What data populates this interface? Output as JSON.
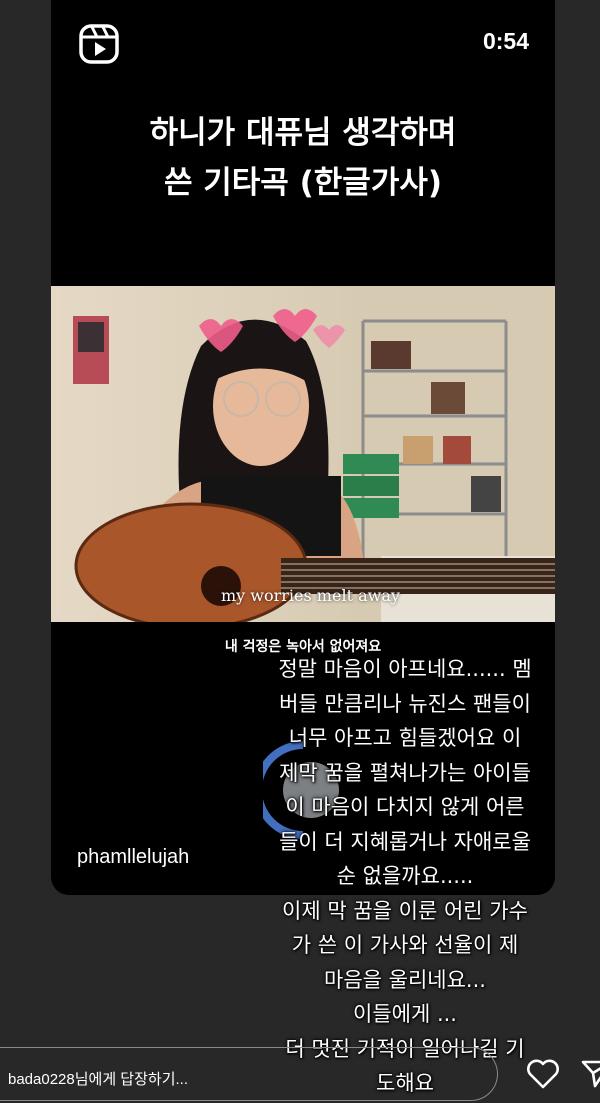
{
  "story": {
    "timer": "0:54",
    "title_line1": "하니가 대퓨님 생각하며",
    "title_line2": "쓴 기타곡 (한글가사)",
    "video_caption": "my worries melt away",
    "korean_subtitle": "내 걱정은 녹아서 없어져요",
    "handle": "phamllelujah",
    "icon": "reels-icon"
  },
  "comment": {
    "text": "정말 마음이 아프네요...... 멤\n버들 만큼리나 뉴진스 팬들이\n너무 아프고 힘들겠어요  이\n제막 꿈을 펼쳐나가는 아이들\n이 마음이 다치지 않게 어른\n들이 더 지혜롭거나 자애로울\n순 없을까요.....\n이제 막 꿈을 이룬 어린 가수\n가  쓴 이 가사와 선율이 제\n마음을 울리네요...\n이들에게 ...\n더 멋진 기적이 일어나길 기\n도해요"
  },
  "reply": {
    "placeholder": "bada0228님에게 답장하기..."
  },
  "actions": {
    "like_icon": "heart-icon",
    "send_icon": "send-icon"
  }
}
